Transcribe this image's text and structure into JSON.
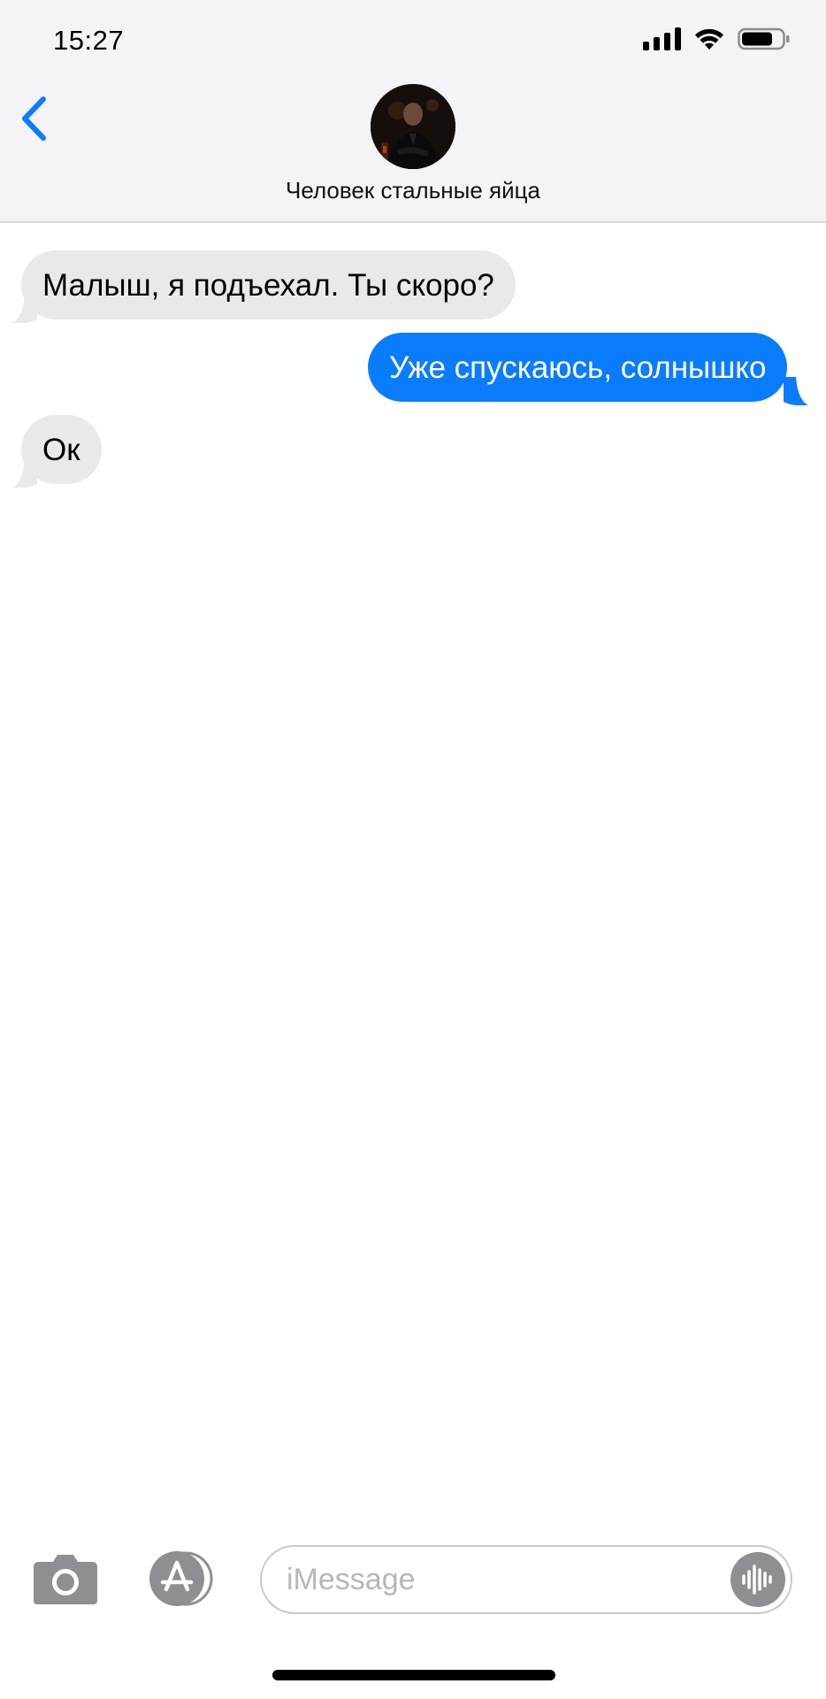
{
  "status_bar": {
    "time": "15:27",
    "icons": [
      "signal-icon",
      "wifi-icon",
      "battery-icon"
    ]
  },
  "header": {
    "back_icon": "chevron-left-icon",
    "contact_name": "Человек стальные яйца",
    "avatar": "contact-photo"
  },
  "messages": [
    {
      "direction": "incoming",
      "text": "Малыш, я подъехал. Ты скоро?"
    },
    {
      "direction": "outgoing",
      "text": "Уже спускаюсь, солнышко"
    },
    {
      "direction": "incoming",
      "text": "Ок"
    }
  ],
  "input_bar": {
    "camera_icon": "camera-icon",
    "appstore_icon": "app-store-icon",
    "placeholder": "iMessage",
    "audio_icon": "audio-waveform-icon"
  },
  "colors": {
    "accent": "#0a7cff",
    "incoming_bubble": "#e9e9eb",
    "header_bg": "#f4f3f8"
  }
}
